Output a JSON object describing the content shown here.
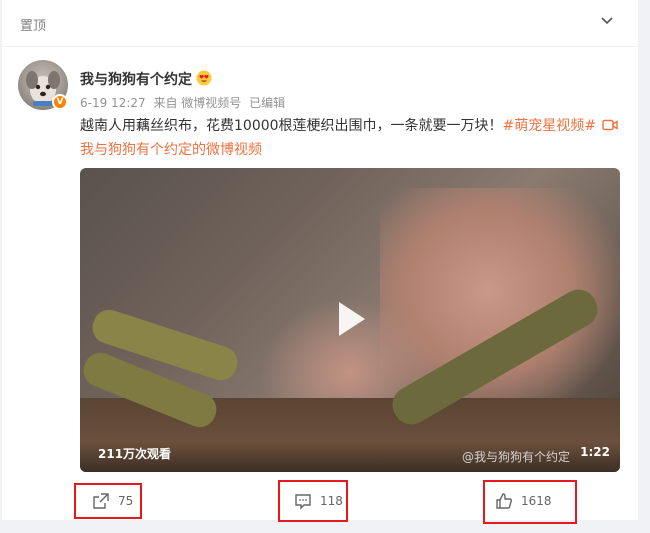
{
  "header": {
    "pinned_label": "置顶",
    "collapse_icon": "chevron-down-icon"
  },
  "post": {
    "author": "我与狗狗有个约定",
    "author_badge_icon": "heart-eyes-emoji-icon",
    "verified_icon": "orange-verified-icon",
    "date": "6-19 12:27",
    "source": "来自 微博视频号",
    "edited": "已编辑",
    "text": "越南人用藕丝织布，花费10000根莲梗织出围巾，一条就要一万块！",
    "hashtag": "#萌宠星视频#",
    "video_link_icon": "video-camera-icon",
    "video_link_text": "我与狗狗有个约定的微博视频"
  },
  "video": {
    "views": "211万次观看",
    "watermark": "@我与狗狗有个约定",
    "duration": "1:22",
    "play_icon": "play-icon"
  },
  "actions": {
    "share_icon": "share-icon",
    "share_count": "75",
    "comment_icon": "comment-icon",
    "comment_count": "118",
    "like_icon": "thumbs-up-icon",
    "like_count": "1618"
  },
  "colors": {
    "accent": "#eb7340",
    "highlight": "#e8191c",
    "verified": "#ff8200"
  }
}
